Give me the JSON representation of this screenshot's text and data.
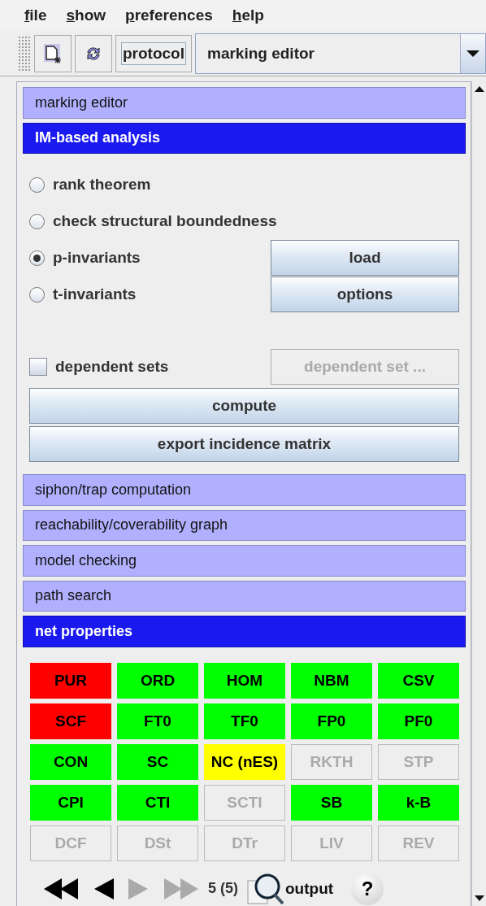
{
  "menu": [
    "file",
    "show",
    "preferences",
    "help"
  ],
  "toolbar": {
    "protocol_button": "protocol",
    "view_select": "marking editor"
  },
  "sections_top": [
    {
      "title": "marking editor",
      "expanded": false
    },
    {
      "title": "IM-based analysis",
      "expanded": true
    }
  ],
  "im_analysis": {
    "options": [
      {
        "label": "rank theorem",
        "selected": false
      },
      {
        "label": "check structural boundedness",
        "selected": false
      },
      {
        "label": "p-invariants",
        "selected": true
      },
      {
        "label": "t-invariants",
        "selected": false
      }
    ],
    "load_button": "load",
    "options_button": "options",
    "dependent_sets": {
      "label": "dependent sets",
      "checked": false
    },
    "dependent_set_button": {
      "label": "dependent set ...",
      "disabled": true
    },
    "compute_button": "compute",
    "export_button": "export incidence matrix"
  },
  "sections_bottom": [
    {
      "title": "siphon/trap computation",
      "expanded": false
    },
    {
      "title": "reachability/coverability graph",
      "expanded": false
    },
    {
      "title": "model checking",
      "expanded": false
    },
    {
      "title": "path search",
      "expanded": false
    },
    {
      "title": "net properties",
      "expanded": true
    }
  ],
  "net_properties": [
    {
      "label": "PUR",
      "color": "#ff0000",
      "disabled": false
    },
    {
      "label": "ORD",
      "color": "#00ff00",
      "disabled": false
    },
    {
      "label": "HOM",
      "color": "#00ff00",
      "disabled": false
    },
    {
      "label": "NBM",
      "color": "#00ff00",
      "disabled": false
    },
    {
      "label": "CSV",
      "color": "#00ff00",
      "disabled": false
    },
    {
      "label": "SCF",
      "color": "#ff0000",
      "disabled": false
    },
    {
      "label": "FT0",
      "color": "#00ff00",
      "disabled": false
    },
    {
      "label": "TF0",
      "color": "#00ff00",
      "disabled": false
    },
    {
      "label": "FP0",
      "color": "#00ff00",
      "disabled": false
    },
    {
      "label": "PF0",
      "color": "#00ff00",
      "disabled": false
    },
    {
      "label": "CON",
      "color": "#00ff00",
      "disabled": false
    },
    {
      "label": "SC",
      "color": "#00ff00",
      "disabled": false
    },
    {
      "label": "NC (nES)",
      "color": "#ffff00",
      "disabled": false
    },
    {
      "label": "RKTH",
      "disabled": true
    },
    {
      "label": "STP",
      "disabled": true
    },
    {
      "label": "CPI",
      "color": "#00ff00",
      "disabled": false
    },
    {
      "label": "CTI",
      "color": "#00ff00",
      "disabled": false
    },
    {
      "label": "SCTI",
      "disabled": true
    },
    {
      "label": "SB",
      "color": "#00ff00",
      "disabled": false
    },
    {
      "label": "k-B",
      "color": "#00ff00",
      "disabled": false
    },
    {
      "label": "DCF",
      "disabled": true
    },
    {
      "label": "DSt",
      "disabled": true
    },
    {
      "label": "DTr",
      "disabled": true
    },
    {
      "label": "LIV",
      "disabled": true
    },
    {
      "label": "REV",
      "disabled": true
    }
  ],
  "navigation": {
    "buttons": [
      {
        "kind": "first",
        "disabled": false
      },
      {
        "kind": "previous",
        "disabled": false
      },
      {
        "kind": "next",
        "disabled": true
      },
      {
        "kind": "last",
        "disabled": true
      }
    ],
    "counter": "5 (5)",
    "output_button": "output",
    "help_button": "?"
  }
}
